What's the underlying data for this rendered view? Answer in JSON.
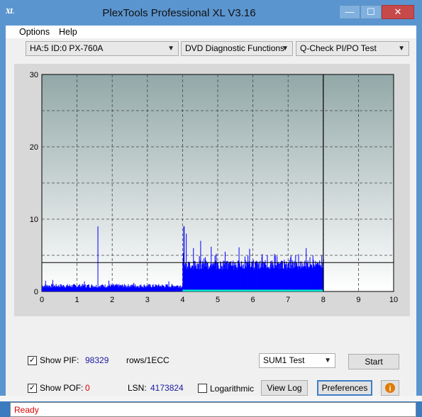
{
  "window": {
    "title": "PlexTools Professional XL V3.16",
    "icon_text": "XL",
    "controls": [
      "—",
      "☐",
      "✕"
    ]
  },
  "menu": {
    "items": [
      "Options",
      "Help"
    ]
  },
  "toolbar": {
    "drive": "HA:5 ID:0  PX-760A",
    "function": "DVD Diagnostic Functions",
    "test": "Q-Check PI/PO Test"
  },
  "chart_data": {
    "type": "bar",
    "x_ticks": [
      "0",
      "1",
      "2",
      "3",
      "4",
      "5",
      "6",
      "7",
      "8",
      "9",
      "10"
    ],
    "y_ticks": [
      "0",
      "10",
      "20",
      "30"
    ],
    "xlim": [
      0,
      10
    ],
    "ylim": [
      0,
      30
    ],
    "threshold_line": 4,
    "end_marker_x": 8,
    "grid": true,
    "series": [
      {
        "color": "#0000ff",
        "segments": [
          {
            "x_start": 0.0,
            "x_end": 4.0,
            "base": 0.8,
            "peaks": [
              [
                0.1,
                1.5
              ],
              [
                0.3,
                1.6
              ],
              [
                1.2,
                1.4
              ],
              [
                1.58,
                9.0
              ],
              [
                1.9,
                1.5
              ],
              [
                2.6,
                1.2
              ],
              [
                3.6,
                1.4
              ]
            ]
          },
          {
            "x_start": 4.0,
            "x_end": 8.0,
            "base": 3.0,
            "peaks": [
              [
                4.03,
                9.0
              ],
              [
                4.1,
                8.0
              ],
              [
                4.3,
                6.0
              ],
              [
                4.5,
                7.0
              ],
              [
                4.8,
                6.2
              ],
              [
                5.2,
                5.5
              ],
              [
                5.6,
                6.1
              ],
              [
                5.9,
                5.9
              ],
              [
                6.4,
                5.0
              ],
              [
                6.6,
                5.2
              ],
              [
                7.2,
                5.0
              ],
              [
                7.5,
                6.0
              ],
              [
                7.7,
                5.0
              ],
              [
                7.95,
                5.0
              ]
            ]
          }
        ]
      },
      {
        "color": "#00e5c8",
        "segments": [
          {
            "x_start": 4.0,
            "x_end": 8.0,
            "base": 0.25,
            "peaks": []
          }
        ]
      }
    ]
  },
  "options": {
    "show_pif_label": "Show PIF:",
    "show_pif_checked": true,
    "pif_value": "98329",
    "pif_unit": "rows/1ECC",
    "show_pof_label": "Show POF:",
    "show_pof_checked": true,
    "pof_value": "0",
    "lsn_label": "LSN:",
    "lsn_value": "4173824",
    "logarithmic_label": "Logarithmic",
    "logarithmic_checked": false,
    "sum_select": "SUM1 Test",
    "start_button": "Start",
    "viewlog_button": "View Log",
    "preferences_button": "Preferences"
  },
  "status": {
    "text": "Ready"
  }
}
